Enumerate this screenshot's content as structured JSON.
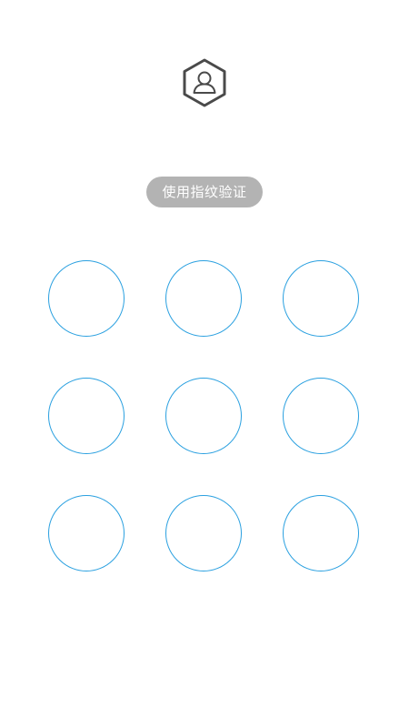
{
  "header": {
    "avatar_icon": "user-hexagon-icon"
  },
  "fingerprint_button": {
    "label": "使用指纹验证"
  },
  "pattern_lock": {
    "rows": 3,
    "cols": 3,
    "dot_color": "#2aa0e0",
    "dots": [
      {
        "id": 1
      },
      {
        "id": 2
      },
      {
        "id": 3
      },
      {
        "id": 4
      },
      {
        "id": 5
      },
      {
        "id": 6
      },
      {
        "id": 7
      },
      {
        "id": 8
      },
      {
        "id": 9
      }
    ]
  },
  "colors": {
    "background": "#ffffff",
    "button_bg": "#b3b3b3",
    "button_text": "#ffffff",
    "icon": "#4a4a4a"
  }
}
